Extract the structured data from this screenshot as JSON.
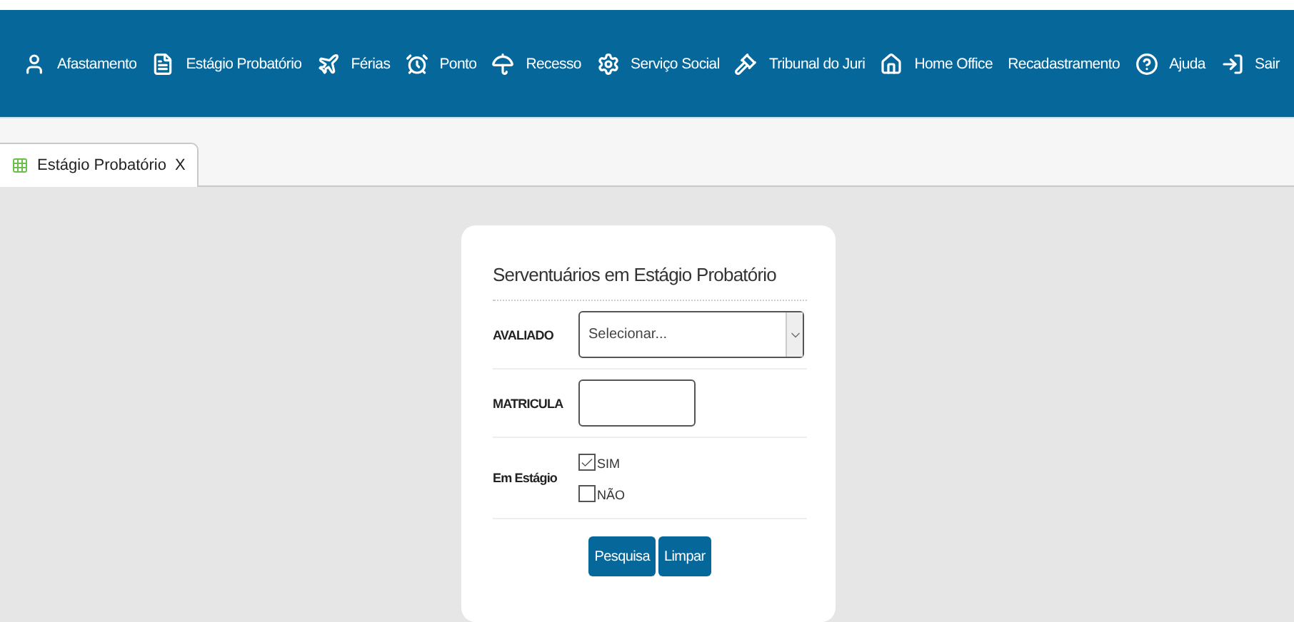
{
  "nav": [
    {
      "label": "Afastamento"
    },
    {
      "label": "Estágio Probatório"
    },
    {
      "label": "Férias"
    },
    {
      "label": "Ponto"
    },
    {
      "label": "Recesso"
    },
    {
      "label": "Serviço Social"
    },
    {
      "label": "Tribunal do Juri"
    },
    {
      "label": "Home Office"
    },
    {
      "label": "Recadastramento"
    },
    {
      "label": "Ajuda"
    },
    {
      "label": "Sair"
    }
  ],
  "tabs": [
    {
      "label": "Estágio Probatório",
      "close": "X",
      "selected": true
    }
  ],
  "form": {
    "title": "Serventuários em Estágio Probatório",
    "avaliado": {
      "label": "AVALIADO",
      "placeholder": "Selecionar..."
    },
    "matricula": {
      "label": "MATRICULA"
    },
    "em_estagio": {
      "label": "Em Estágio",
      "options": [
        {
          "label": "SIM",
          "checked": true
        },
        {
          "label": "NÃO",
          "checked": false
        }
      ]
    },
    "buttons": [
      "Pesquisa",
      "Limpar"
    ]
  }
}
